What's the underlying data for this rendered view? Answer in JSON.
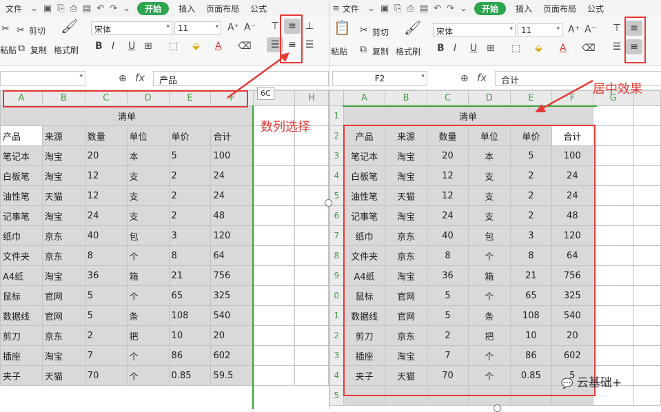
{
  "menu": {
    "file": "文件",
    "start": "开始",
    "insert": "插入",
    "layout": "页面布局",
    "formula": "公式"
  },
  "ribbon": {
    "cut": "剪切",
    "paste_short": "粘贴",
    "paste": "粘贴",
    "copy": "复制",
    "format_painter": "格式刷",
    "font": "宋体",
    "size": "11"
  },
  "left": {
    "formula_value": "产品",
    "columns": [
      "A",
      "B",
      "C",
      "D",
      "E",
      "F",
      "H"
    ],
    "title": "清单",
    "tooltip": "6C",
    "header": [
      "产品",
      "来源",
      "数量",
      "单位",
      "单价",
      "合计"
    ],
    "rows": [
      [
        "笔记本",
        "淘宝",
        "20",
        "本",
        "5",
        "100"
      ],
      [
        "白板笔",
        "淘宝",
        "12",
        "支",
        "2",
        "24"
      ],
      [
        "油性笔",
        "天猫",
        "12",
        "支",
        "2",
        "24"
      ],
      [
        "记事笔",
        "淘宝",
        "24",
        "支",
        "2",
        "48"
      ],
      [
        "纸巾",
        "京东",
        "40",
        "包",
        "3",
        "120"
      ],
      [
        "文件夹",
        "京东",
        "8",
        "个",
        "8",
        "64"
      ],
      [
        "A4纸",
        "淘宝",
        "36",
        "箱",
        "21",
        "756"
      ],
      [
        "鼠标",
        "官网",
        "5",
        "个",
        "65",
        "325"
      ],
      [
        "数据线",
        "官网",
        "5",
        "条",
        "108",
        "540"
      ],
      [
        "剪刀",
        "京东",
        "2",
        "把",
        "10",
        "20"
      ],
      [
        "插座",
        "淘宝",
        "7",
        "个",
        "86",
        "602"
      ],
      [
        "夹子",
        "天猫",
        "70",
        "个",
        "0.85",
        "59.5"
      ]
    ]
  },
  "right": {
    "name_box": "F2",
    "formula_value": "合计",
    "columns": [
      "A",
      "B",
      "C",
      "D",
      "E",
      "F",
      "G"
    ],
    "row_numbers": [
      "1",
      "2",
      "3",
      "4",
      "5",
      "6",
      "7",
      "8",
      "9",
      "0",
      "1",
      "2",
      "3",
      "4",
      "5"
    ],
    "title": "清单",
    "header": [
      "产品",
      "来源",
      "数量",
      "单位",
      "单价",
      "合计"
    ],
    "rows": [
      [
        "笔记本",
        "淘宝",
        "20",
        "本",
        "5",
        "100"
      ],
      [
        "白板笔",
        "淘宝",
        "12",
        "支",
        "2",
        "24"
      ],
      [
        "油性笔",
        "天猫",
        "12",
        "支",
        "2",
        "24"
      ],
      [
        "记事笔",
        "淘宝",
        "24",
        "支",
        "2",
        "48"
      ],
      [
        "纸巾",
        "京东",
        "40",
        "包",
        "3",
        "120"
      ],
      [
        "文件夹",
        "京东",
        "8",
        "个",
        "8",
        "64"
      ],
      [
        "A4纸",
        "淘宝",
        "36",
        "箱",
        "21",
        "756"
      ],
      [
        "鼠标",
        "官网",
        "5",
        "个",
        "65",
        "325"
      ],
      [
        "数据线",
        "官网",
        "5",
        "条",
        "108",
        "540"
      ],
      [
        "剪刀",
        "京东",
        "2",
        "把",
        "10",
        "20"
      ],
      [
        "插座",
        "淘宝",
        "7",
        "个",
        "86",
        "602"
      ],
      [
        "夹子",
        "天猫",
        "70",
        "个",
        "0.85",
        "5"
      ]
    ]
  },
  "annotations": {
    "select_columns": "数列选择",
    "center_effect": "居中效果"
  },
  "watermark": "云基础+",
  "colors": {
    "accent_green": "#2ea44f",
    "annotation_red": "#e53935",
    "selection_gray": "#d9d9d9"
  }
}
